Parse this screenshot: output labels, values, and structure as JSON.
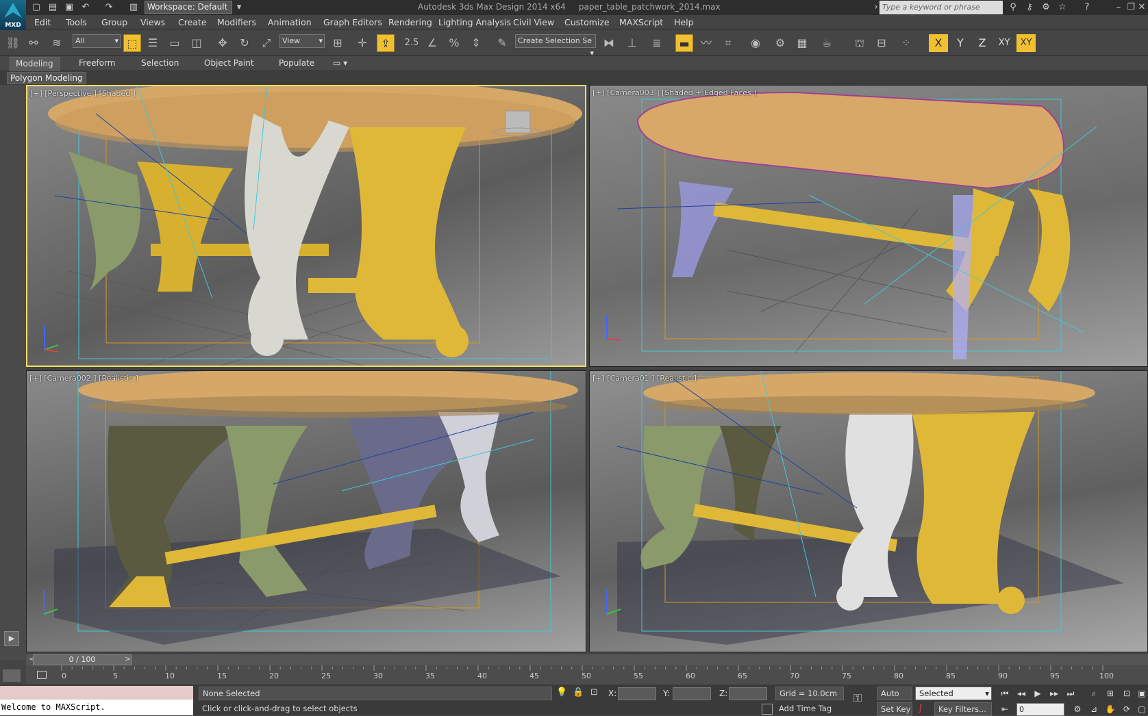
{
  "titlebar": {
    "app_title": "Autodesk 3ds Max Design 2014 x64",
    "file_name": "paper_table_patchwork_2014.max",
    "workspace_label": "Workspace: Default",
    "search_placeholder": "Type a keyword or phrase",
    "logo_text": "MXD"
  },
  "menu": [
    "Edit",
    "Tools",
    "Group",
    "Views",
    "Create",
    "Modifiers",
    "Animation",
    "Graph Editors",
    "Rendering",
    "Lighting Analysis",
    "Civil View",
    "Customize",
    "MAXScript",
    "Help"
  ],
  "toolbar": {
    "selection_filter": "All",
    "ref_coord": "View",
    "selection_set_placeholder": "Create Selection Se",
    "snap_label": "2.5",
    "axis": [
      "X",
      "Y",
      "Z",
      "XY",
      "XY"
    ]
  },
  "ribbon": {
    "tabs": [
      "Modeling",
      "Freeform",
      "Selection",
      "Object Paint",
      "Populate"
    ],
    "active_tab": "Modeling",
    "panel": "Polygon Modeling"
  },
  "viewports": [
    {
      "label": "[+] [Perspective ] [Shaded ]",
      "active": true
    },
    {
      "label": "[+] [Camera003 ] [Shaded + Edged Faces ]",
      "active": false
    },
    {
      "label": "[+] [Camera002 ] [Realistic ]",
      "active": false
    },
    {
      "label": "[+] [Camera01 ] [Realistic ]",
      "active": false
    }
  ],
  "timeline": {
    "frame_display": "0 / 100",
    "ticks": [
      "0",
      "5",
      "10",
      "15",
      "20",
      "25",
      "30",
      "35",
      "40",
      "45",
      "50",
      "55",
      "60",
      "65",
      "70",
      "75",
      "80",
      "85",
      "90",
      "95",
      "100"
    ]
  },
  "status": {
    "maxscript_output": "Welcome to MAXScript.",
    "selection": "None Selected",
    "prompt": "Click or click-and-drag to select objects",
    "x_label": "X:",
    "y_label": "Y:",
    "z_label": "Z:",
    "grid": "Grid = 10.0cm",
    "add_time_tag": "Add Time Tag",
    "auto_key": "Auto Key",
    "set_key": "Set Key",
    "key_mode": "Selected",
    "key_filters": "Key Filters...",
    "current_frame": "0"
  }
}
